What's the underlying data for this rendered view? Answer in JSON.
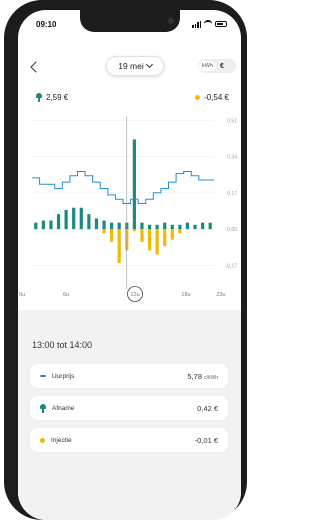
{
  "status_bar": {
    "time": "09:10"
  },
  "header": {
    "date": "19 mei",
    "unit_kwh": "kWh",
    "unit_eur": "€"
  },
  "summary": {
    "afname_total": "2,59 €",
    "injectie_total": "-0,54 €"
  },
  "colors": {
    "afname": "#1a8a7e",
    "injectie": "#f5b800",
    "uurprijs": "#1e8fd6"
  },
  "chart_data": {
    "type": "bar",
    "x_tick_labels": [
      "0u",
      "6u",
      "12u",
      "18u",
      "23u"
    ],
    "selected_tick": "12u",
    "y_tick_labels": [
      "0,51",
      "0,34",
      "0,17",
      "0,00",
      "-0,17"
    ],
    "ylim": [
      -0.22,
      0.53
    ],
    "series": [
      {
        "values": [
          0.03,
          0.04,
          0.04,
          0.07,
          0.09,
          0.1,
          0.1,
          0.07,
          0.05,
          0.04,
          0.03,
          0.03,
          0.03,
          0.42,
          0.03,
          0.02,
          0.02,
          0.03,
          0.02,
          0.02,
          0.03,
          0.02,
          0.03,
          0.03
        ]
      },
      {
        "values": [
          0,
          0,
          0,
          0,
          0,
          0,
          0,
          0,
          0,
          -0.02,
          -0.06,
          -0.16,
          -0.1,
          -0.01,
          -0.06,
          -0.1,
          -0.12,
          -0.08,
          -0.05,
          -0.02,
          0,
          0,
          0,
          0
        ]
      },
      {
        "values": [
          0.24,
          0.21,
          0.21,
          0.19,
          0.22,
          0.25,
          0.27,
          0.25,
          0.22,
          0.19,
          0.16,
          0.14,
          0.12,
          0.14,
          0.12,
          0.14,
          0.17,
          0.19,
          0.22,
          0.26,
          0.27,
          0.25,
          0.23,
          0.23
        ]
      }
    ]
  },
  "detail": {
    "period": "13:00 tot 14:00",
    "rows": [
      {
        "label": "Uurprijs",
        "value": "5,78",
        "unit": "c/kWh"
      },
      {
        "label": "Afname",
        "value": "0,42 €"
      },
      {
        "label": "Injectie",
        "value": "-0,01 €"
      }
    ]
  }
}
